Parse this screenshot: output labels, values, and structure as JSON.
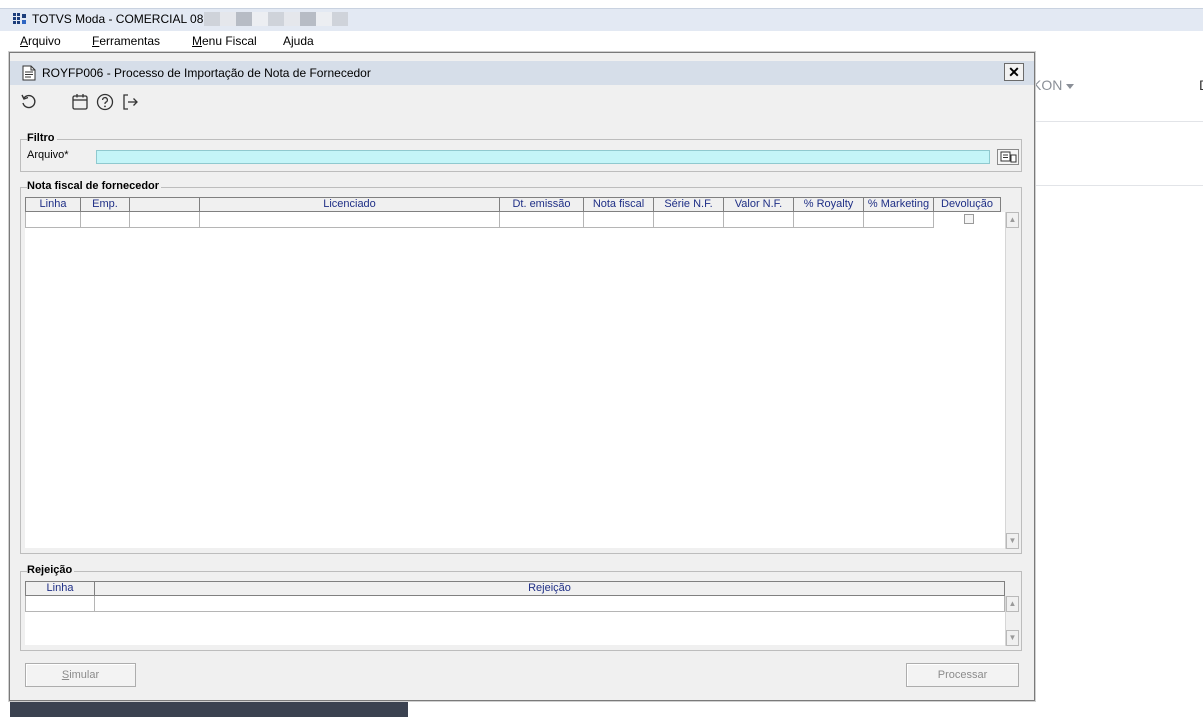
{
  "app": {
    "title": "TOTVS Moda - COMERCIAL 08 -",
    "menu": {
      "arquivo_u": "A",
      "arquivo_rest": "rquivo",
      "ferramentas_u": "F",
      "ferramentas_rest": "erramentas",
      "menufiscal_u": "M",
      "menufiscal_rest": "enu Fiscal",
      "ajuda": "Ajuda"
    },
    "background": {
      "kon": "KON",
      "d": "D"
    }
  },
  "dialog": {
    "title": "ROYFP006 - Processo de Importação de Nota de Fornecedor",
    "close": "✕",
    "filtro": {
      "legend": "Filtro",
      "arquivo_label": "Arquivo*",
      "arquivo_value": ""
    },
    "nota": {
      "legend": "Nota fiscal de fornecedor",
      "columns": [
        "Linha",
        "Emp.",
        "",
        "Licenciado",
        "Dt. emissão",
        "Nota fiscal",
        "Série N.F.",
        "Valor N.F.",
        "% Royalty",
        "% Marketing",
        "Devolução"
      ]
    },
    "rejeicao": {
      "legend": "Rejeição",
      "columns": [
        "Linha",
        "Rejeição"
      ]
    },
    "buttons": {
      "simular_u": "S",
      "simular_rest": "imular",
      "processar": "Processar"
    }
  },
  "colors": {
    "required_field": "#c4f5f8",
    "header_text": "#1f2f86",
    "title_bar": "#d6dee9"
  }
}
